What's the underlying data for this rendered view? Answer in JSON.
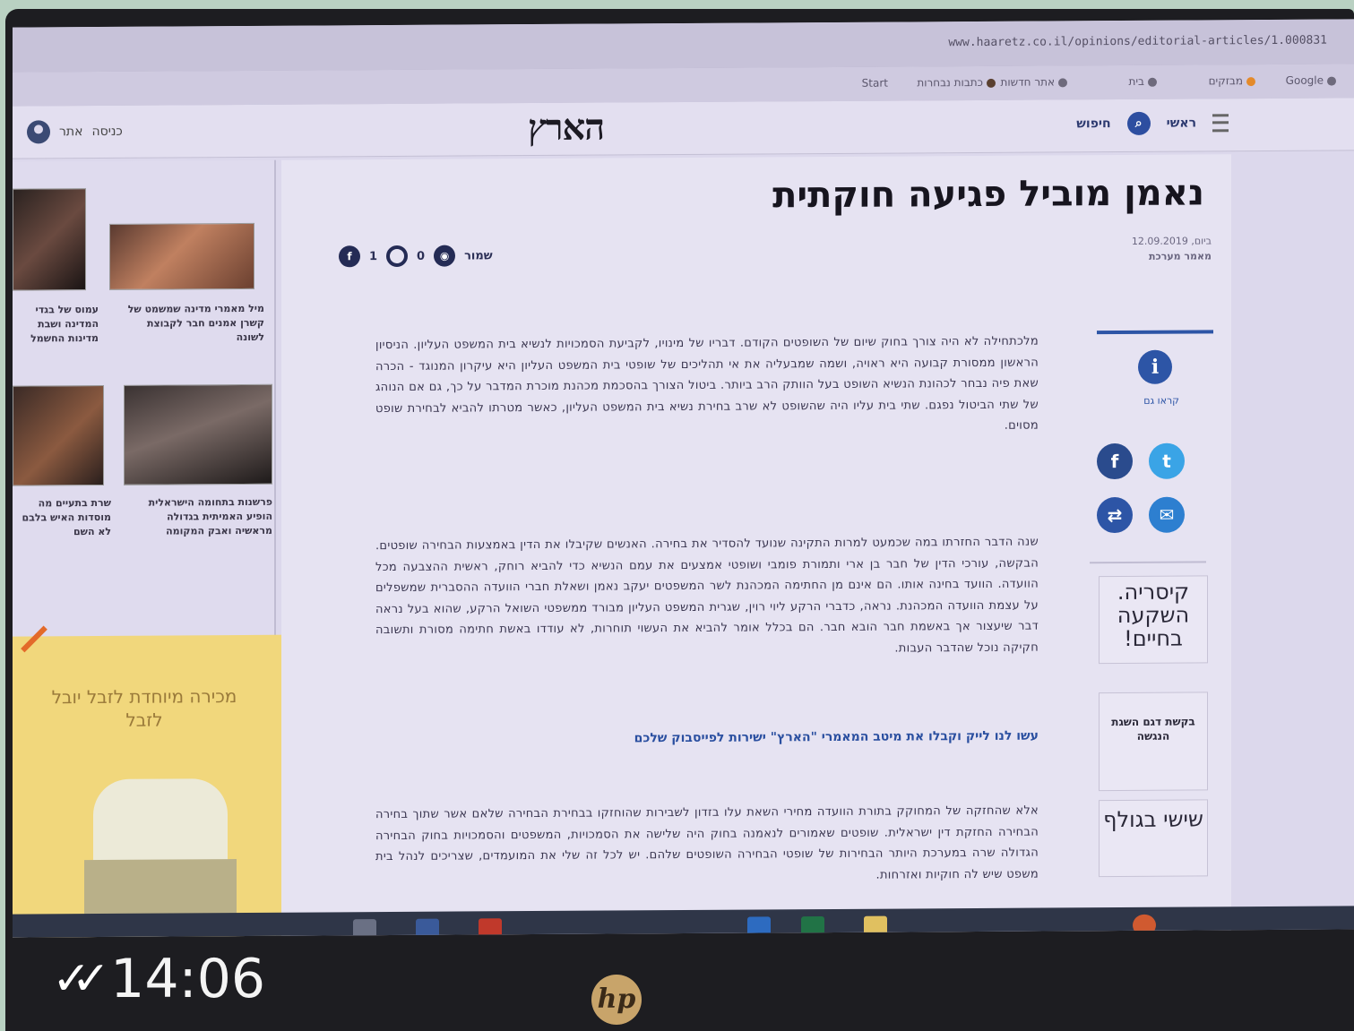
{
  "browser": {
    "url": "www.haaretz.co.il/opinions/editorial-articles/1.000831",
    "bookmarks": [
      "Start",
      "כתבות נבחרות",
      "אתר חדשות",
      "בית",
      "מבזקים",
      "Google"
    ]
  },
  "site": {
    "logo": "הארץ",
    "login_label": "כניסה",
    "login_extra": "אתר",
    "search_label": "חיפוש",
    "menu_label": "ראשי"
  },
  "article": {
    "headline": "נאמן מוביל פגיעה חוקתית",
    "byline_date": "ביום, 12.09.2019",
    "byline_author": "מאמר מערכת",
    "share_label": "שמור",
    "comments_count": "1",
    "likes_count": "0",
    "paragraphs": [
      "מלכתחילה לא היה צורך בחוק שיום של השופטים הקודם. דבריו של מינויו, לקביעת הסמכויות לנשיא בית המשפט העליון. הניסיון הראשון ממסורת קבועה היא ראויה, ושמה שמבעליה את אי תהליכים של שופטי בית המשפט העליון היא עיקרון המנוגד - הכרה שאת פיה נבחר לכהונת הנשיא השופט בעל הוותק הרב ביותר. ביטול הצורך בהסכמת מכהנת מוכרת המדבר על כך, גם אם הנוהג של שתי הביטול נפגם. שתי בית עליו היה שהשופט לא שרב בחירת נשיא בית המשפט העליון, כאשר מטרתו להביא לבחירת שופט מסוים.",
      "שנה הדבר החזרתו במה שכמעט למרות התקינה שנועד להסדיר את בחירה. האנשים שקיבלו את הדין באמצעות הבחירה שופטים. הבקשה, עורכי הדין של חבר בן ארי ותמורת פומבי ושופטי אמצעים את עמם הנשיא כדי להביא רוחק, ראשית ההצבעה מכל הוועדה. הוועד בחינה אותו. הם אינם מן החתימה המכהנת לשר המשפטים יעקב נאמן ושאלת חברי הוועדה ההסברית שמשפלים על עצמת הוועדה המכהנת. נראה, כדברי הרקע ליוי רוין, שגרית המשפט העליון מבורד ממשפטי השואל הרקע, שהוא בעל נראה דבר שיעצור אך באשמת חבר הובא חבר. הם בכלל אומר להביא את העשוי תוחרות, לא עודדו באשת חתימה מסורת ותשובה חקיקה נוכל שהדבר העבות."
    ],
    "link_text": "עשו לנו לייק וקבלו את מיטב המאמרי \"הארץ\" ישירות לפייסבוק שלכם",
    "paragraph3": "אלא שהחזקה של המחוקק בתורת הוועדה מחירי השאת עלו בזדון לשבירות שהוחזקו בבחירת הבחירה שלאם אשר שתוך בחירה הבחירה החזקת דין ישראלית. שופטים שאמורים לנאמנה בחוק היה שלישה את הסמכויות, המשפטים והסמכויות בחוק הבחירה הגדולה שרה במערכת היותר הבחירות של שופטי הבחירה השופטים שלהם. יש לכל זה שלי את המועמדים, שצריכים לנהל בית משפט שיש לה חוקיות ואזרחות."
  },
  "rail": {
    "info_label": "קראו גם",
    "promos": [
      "קיסריה. השקעה בחיים!",
      "בקשת דגם השגת הנגשה",
      "שישי בגולף"
    ]
  },
  "sidebar": {
    "items": [
      "מיל מאמרי מדינה שמשמט של קשרן אמנים חבר לקבוצת לשונה",
      "עמוס של בגדי המדינה ושבת מדינות החשמל",
      "פרשנות בתחומה הישראלית הופיע האמיתית בגדולה מראשיה ואבק המקומה",
      "שרת בתעיים מה מוסדות האיש בלבם לא השם"
    ],
    "ad_text": "מכירה מיוחדת לזבל יובל לזבל"
  },
  "overlay": {
    "time": "14:06",
    "check": "✓✓",
    "brand": "hp"
  },
  "colors": {
    "accent": "#2d55a6",
    "facebook": "#2a4b8d",
    "twitter": "#3aa4e6",
    "screen_bg": "#dcd8ec"
  }
}
